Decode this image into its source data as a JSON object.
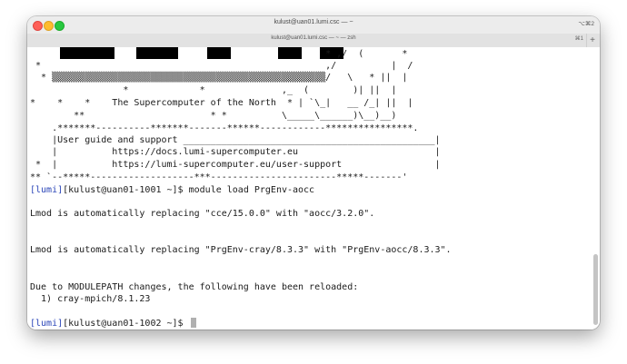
{
  "window": {
    "title": "kulust@uan01.lumi.csc — ~",
    "title_shortcut": "⌥⌘2",
    "tab_title": "kulust@uan01.lumi.csc — ~ — zsh",
    "tab_shortcut": "⌘1",
    "new_tab": "+"
  },
  "terminal": {
    "banner": [
      "                                                      * ,/  (       *",
      " *                                                    ,/          |  /",
      "  * ▒▒▒▒▒▒▒▒▒▒▒▒▒▒▒▒▒▒▒▒▒▒▒▒▒▒▒▒▒▒▒▒▒▒▒▒▒▒▒▒▒▒▒▒▒▒▒▒▒▒/   \\   * ||  |",
      "                 *             *              ,_  (        )| ||  |",
      "*    *    *    The Supercomputer of the North  * | `\\_|   __ /_| ||  |",
      "        **                       * *          \\_____\\______)\\__)__)",
      "    .*******----------*******-------******------------****************.",
      "    |User guide and support ______________________________________________|",
      "    |          https://docs.lumi-supercomputer.eu                         |",
      " *  |          https://lumi-supercomputer.eu/user-support                 |",
      "** `--*****-------------------***-----------------------*****-------'"
    ],
    "prompt1_host": "[lumi]",
    "prompt1_user": "[kulust@uan01-1001 ~]$ ",
    "command1": "module load PrgEnv-aocc",
    "output": [
      "Lmod is automatically replacing \"cce/15.0.0\" with \"aocc/3.2.0\".",
      "Lmod is automatically replacing \"PrgEnv-cray/8.3.3\" with \"PrgEnv-aocc/8.3.3\".",
      "Due to MODULEPATH changes, the following have been reloaded:",
      "  1) cray-mpich/8.1.23"
    ],
    "prompt2_host": "[lumi]",
    "prompt2_user": "[kulust@uan01-1002 ~]$ ",
    "colors": {
      "prompt_host": "#2a45b8",
      "text": "#1b1b1b",
      "background": "#ffffff"
    }
  }
}
